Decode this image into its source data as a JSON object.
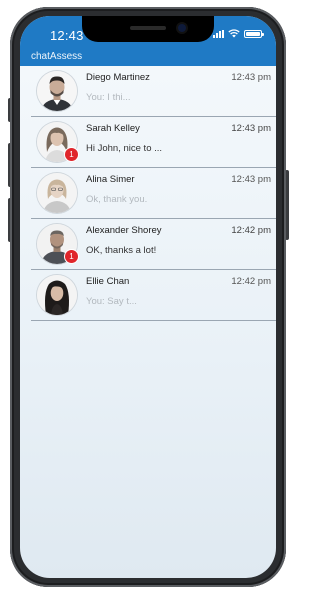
{
  "status_bar": {
    "time": "12:43"
  },
  "app": {
    "title": "chatAssess"
  },
  "chats": [
    {
      "name": "Diego Martinez",
      "time": "12:43 pm",
      "preview": "You: I thi...",
      "unread": false,
      "badge": ""
    },
    {
      "name": "Sarah Kelley",
      "time": "12:43 pm",
      "preview": "Hi John, nice to ...",
      "unread": true,
      "badge": "1"
    },
    {
      "name": "Alina Simer",
      "time": "12:43 pm",
      "preview": "Ok, thank you.",
      "unread": false,
      "badge": ""
    },
    {
      "name": "Alexander Shorey",
      "time": "12:42 pm",
      "preview": "OK, thanks a lot!",
      "unread": true,
      "badge": "1"
    },
    {
      "name": "Ellie Chan",
      "time": "12:42 pm",
      "preview": "You: Say t...",
      "unread": false,
      "badge": ""
    }
  ],
  "colors": {
    "header": "#1f7ac5",
    "badge": "#e0262b",
    "frame": "#2b2d30"
  }
}
